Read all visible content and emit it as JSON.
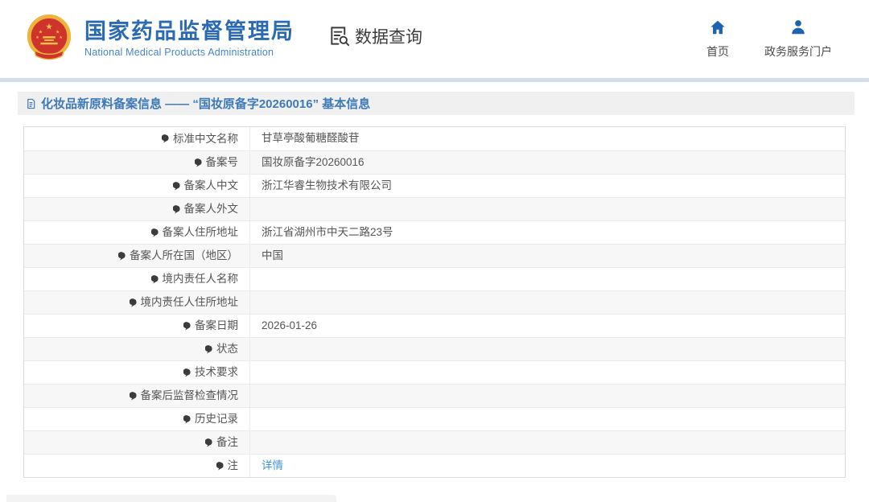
{
  "header": {
    "brand": {
      "title_cn": "国家药品监督管理局",
      "title_en": "National Medical Products Administration",
      "emblem_icon": "china-national-emblem"
    },
    "section_label": "数据查询",
    "section_icon": "document-search-icon",
    "nav": [
      {
        "label": "首页",
        "icon": "home-icon"
      },
      {
        "label": "政务服务门户",
        "icon": "user-icon"
      }
    ]
  },
  "page": {
    "title_icon": "document-icon",
    "title": "化妆品新原料备案信息 —— “国妆原备字20260016” 基本信息"
  },
  "table": {
    "rows": [
      {
        "label": "标准中文名称",
        "value": "甘草亭酸葡糖醛酸苷"
      },
      {
        "label": "备案号",
        "value": "国妆原备字20260016"
      },
      {
        "label": "备案人中文",
        "value": "浙江华睿生物技术有限公司"
      },
      {
        "label": "备案人外文",
        "value": ""
      },
      {
        "label": "备案人住所地址",
        "value": "浙江省湖州市中天二路23号"
      },
      {
        "label": "备案人所在国（地区）",
        "value": "中国"
      },
      {
        "label": "境内责任人名称",
        "value": ""
      },
      {
        "label": "境内责任人住所地址",
        "value": ""
      },
      {
        "label": "备案日期",
        "value": "2026-01-26"
      },
      {
        "label": "状态",
        "value": ""
      },
      {
        "label": "技术要求",
        "value": ""
      },
      {
        "label": "备案后监督检查情况",
        "value": ""
      },
      {
        "label": "历史记录",
        "value": ""
      },
      {
        "label": "备注",
        "value": ""
      },
      {
        "label": "注",
        "label_icon": "pin-icon",
        "value": "详情",
        "link": true
      }
    ]
  },
  "colors": {
    "brand_blue": "#2a6ab2",
    "nav_icon_blue": "#1f62b0",
    "page_title_blue": "#3e79b8",
    "link_blue": "#4094e0",
    "row_alt_bg": "#f7f7f7",
    "divider_band": "#d2dee9",
    "emblem_red": "#cf342c",
    "emblem_gold": "#eeb53e"
  }
}
